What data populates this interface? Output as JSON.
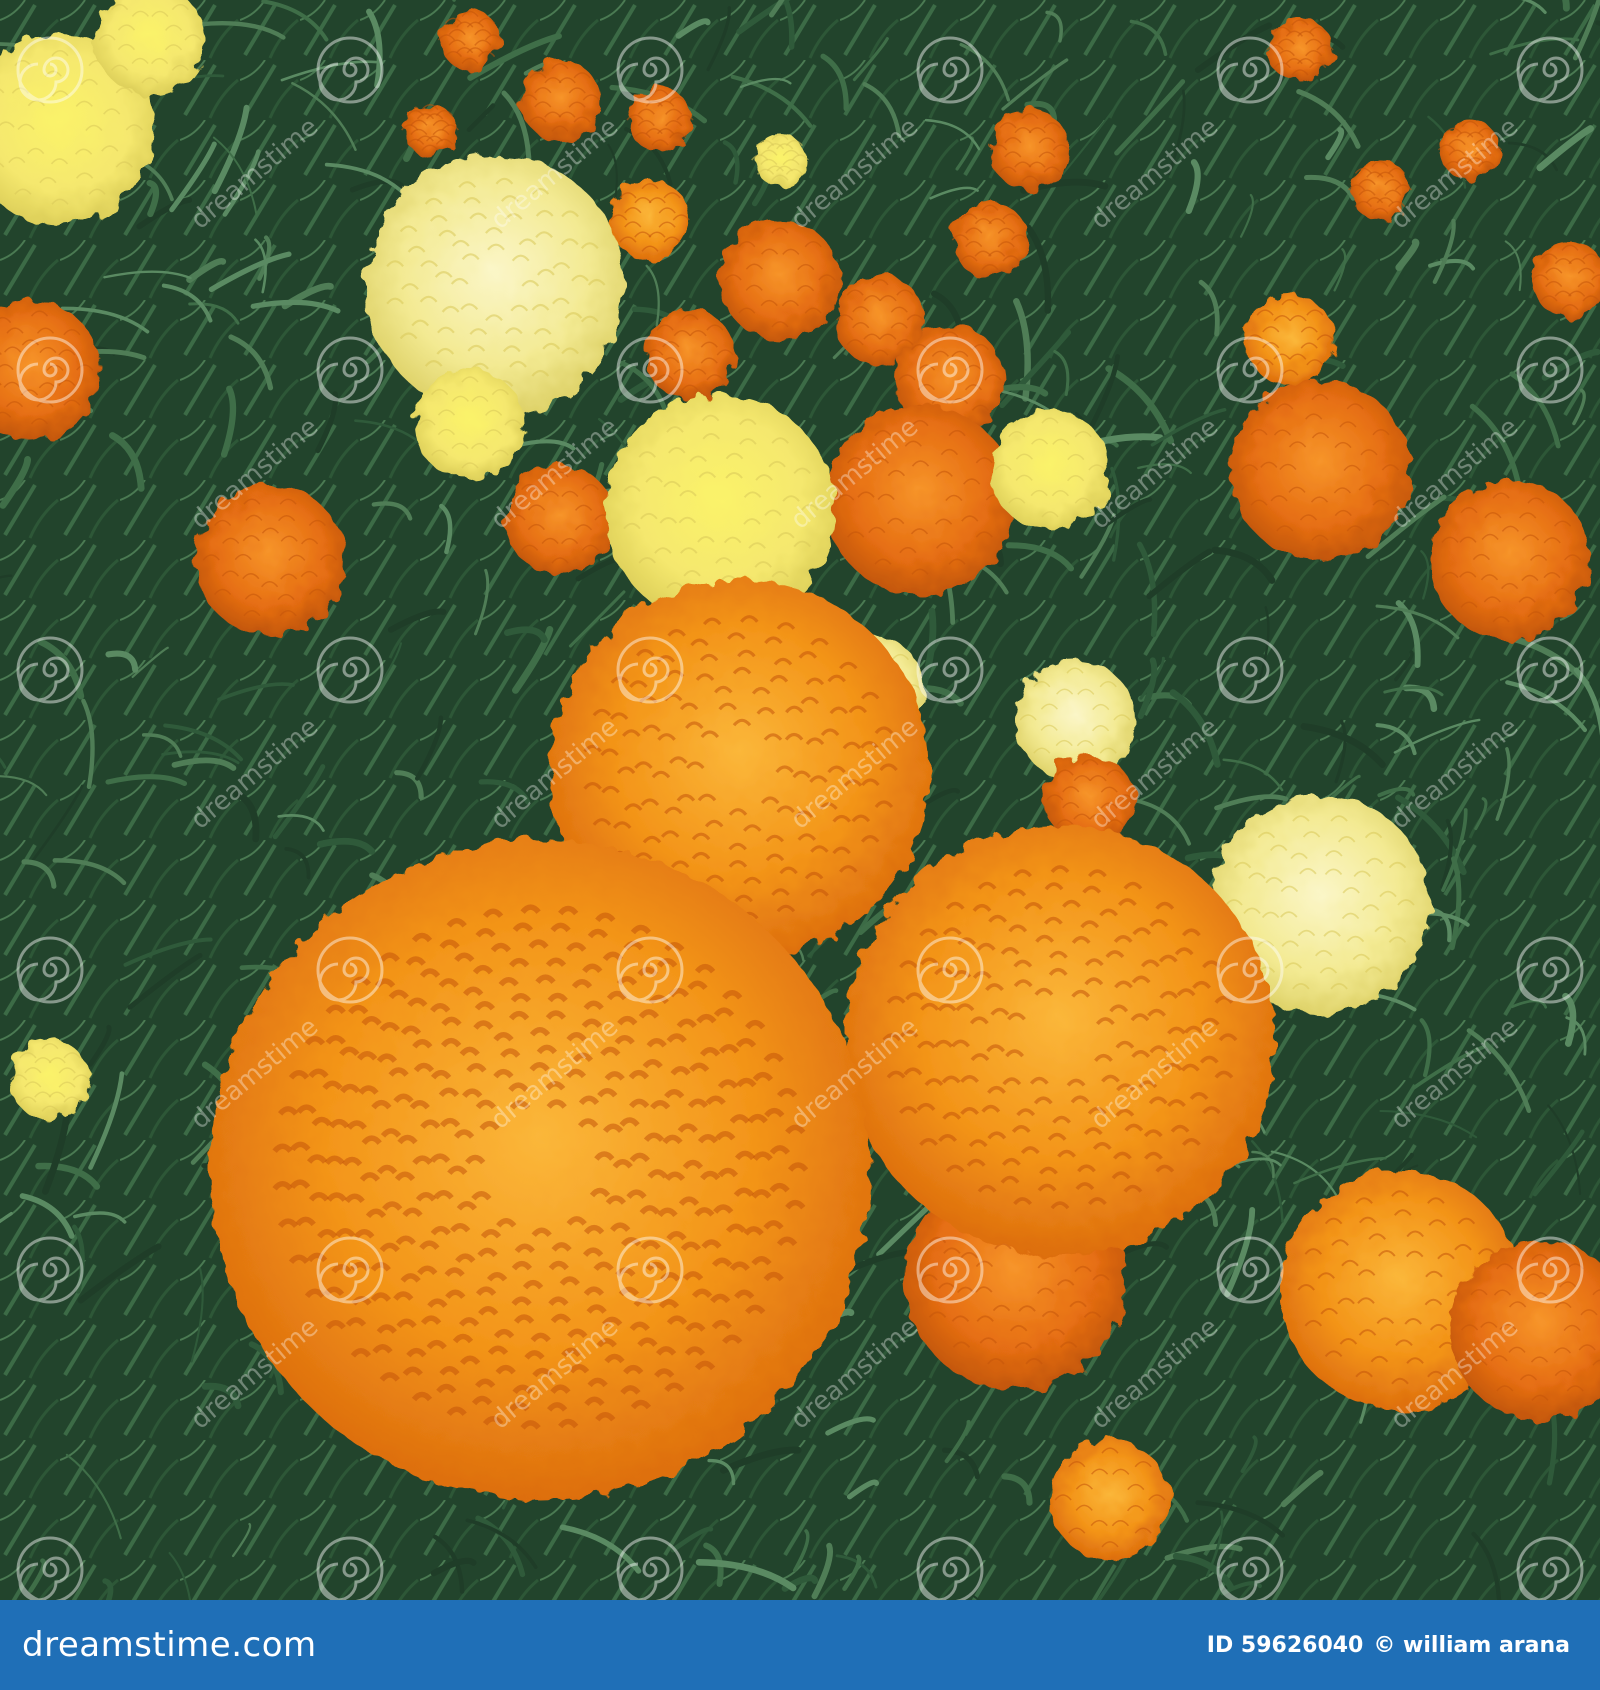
{
  "photo": {
    "description_free": true,
    "colors": {
      "foliage_dark": "#1c3a25",
      "foliage_mid": "#2f5a3a",
      "foliage_light": "#4f7d56",
      "orange_deep": "#e2650f",
      "orange": "#f28a14",
      "orange_light": "#f9ad2d",
      "yellow": "#f6ec8a",
      "yellow_pale": "#f7f1b5"
    }
  },
  "watermark": {
    "text": "dreamstime"
  },
  "footer": {
    "logo": "dreamstime.com",
    "id_label": "ID 59626040",
    "copyright": "© william arana"
  }
}
